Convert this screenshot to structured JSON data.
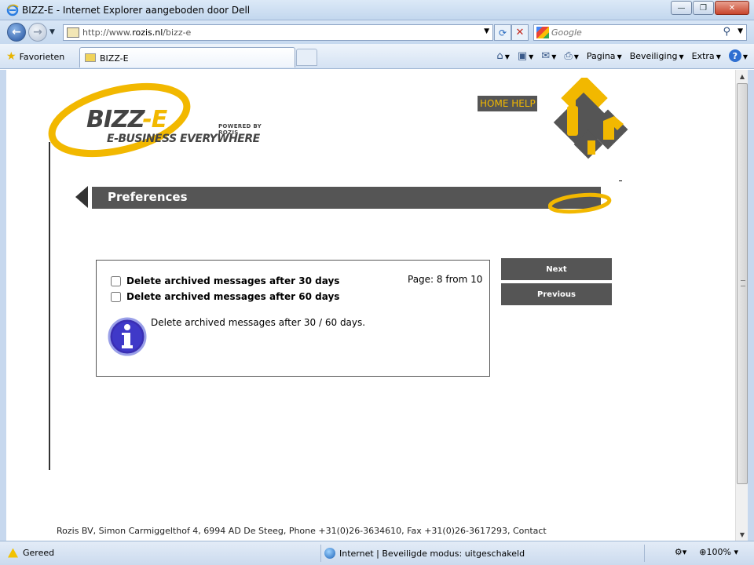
{
  "window": {
    "title": "BIZZ-E - Internet Explorer aangeboden door Dell"
  },
  "address": {
    "url_prefix": "http://www.",
    "url_domain": "rozis.nl",
    "url_path": "/bizz-e"
  },
  "search": {
    "placeholder": "Google"
  },
  "tabs": {
    "favorites_label": "Favorieten",
    "active_tab": "BIZZ-E"
  },
  "commands": {
    "page": "Pagina",
    "security": "Beveiliging",
    "extra": "Extra"
  },
  "page": {
    "logo_main_1": "BIZZ",
    "logo_main_2": "-E",
    "logo_powered": "POWERED BY ROZIS",
    "logo_tagline": "E-BUSINESS EVERYWHERE",
    "home_help": "HOME HELP",
    "section_title": "Preferences",
    "options": [
      {
        "label": "Delete archived messages after 30 days",
        "checked": false
      },
      {
        "label": "Delete archived messages after 60 days",
        "checked": false
      }
    ],
    "page_count": "Page: 8 from 10",
    "info_text": "Delete archived messages after 30 / 60 days.",
    "next_label": "Next",
    "previous_label": "Previous",
    "footer": "Rozis BV, Simon Carmiggelthof 4, 6994 AD De Steeg, Phone +31(0)26-3634610, Fax +31(0)26-3617293, Contact"
  },
  "status": {
    "ready": "Gereed",
    "zone": "Internet | Beveiligde modus: uitgeschakeld",
    "zoom": "100%"
  },
  "colors": {
    "accent": "#f2b800",
    "bar": "#555555"
  }
}
